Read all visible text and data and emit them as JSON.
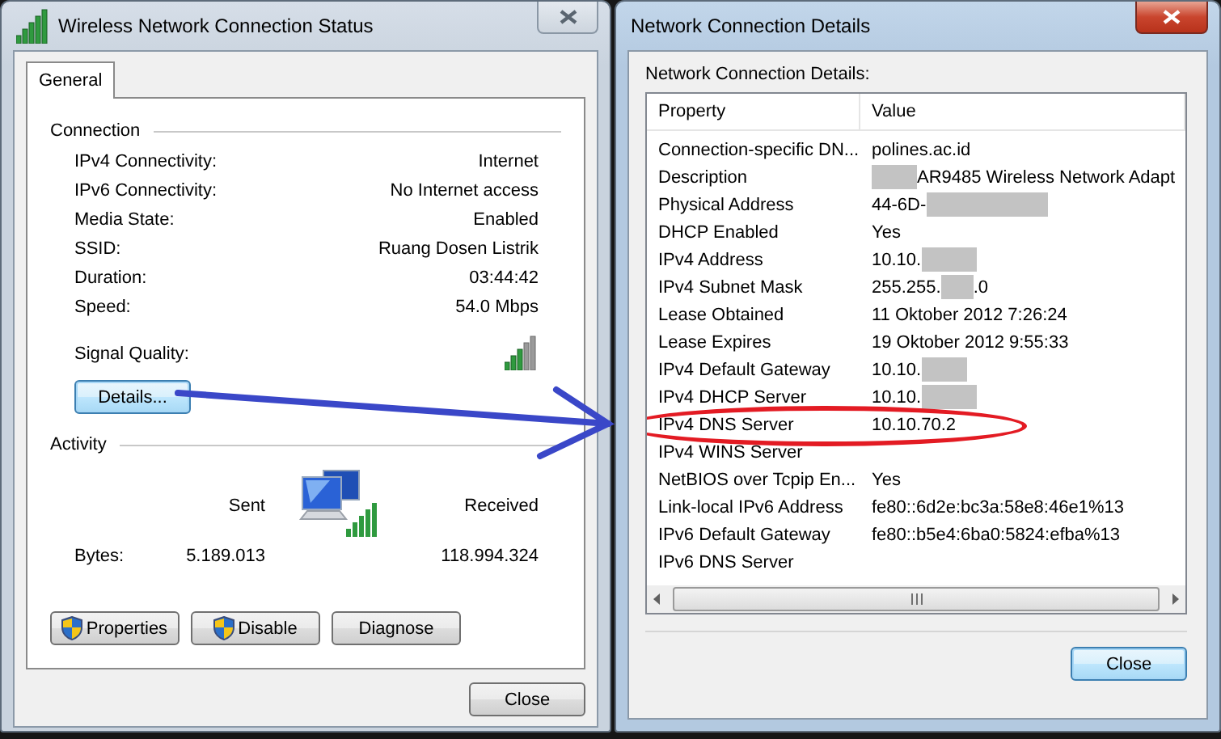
{
  "status_window": {
    "title": "Wireless Network Connection Status",
    "active": false,
    "tabs": [
      {
        "label": "General",
        "selected": true
      }
    ],
    "connection": {
      "heading": "Connection",
      "rows": [
        {
          "label": "IPv4 Connectivity:",
          "value": "Internet"
        },
        {
          "label": "IPv6 Connectivity:",
          "value": "No Internet access"
        },
        {
          "label": "Media State:",
          "value": "Enabled"
        },
        {
          "label": "SSID:",
          "value": "Ruang Dosen Listrik"
        },
        {
          "label": "Duration:",
          "value": "03:44:42"
        },
        {
          "label": "Speed:",
          "value": "54.0 Mbps"
        }
      ],
      "signal_label": "Signal Quality:"
    },
    "details_button": "Details...",
    "activity": {
      "heading": "Activity",
      "sent_label": "Sent",
      "received_label": "Received",
      "bytes_label": "Bytes:",
      "sent_value": "5.189.013",
      "received_value": "118.994.324"
    },
    "buttons": [
      {
        "label": "Properties",
        "kind": "shield"
      },
      {
        "label": "Disable",
        "kind": "shield"
      },
      {
        "label": "Diagnose",
        "kind": "plain"
      }
    ],
    "close_button": "Close"
  },
  "details_window": {
    "title": "Network Connection Details",
    "active": true,
    "list_label": "Network Connection Details:",
    "columns": [
      "Property",
      "Value"
    ],
    "rows": [
      {
        "property": "Connection-specific DN...",
        "value": [
          {
            "kind": "text",
            "text": "polines.ac.id"
          }
        ],
        "highlighted": false
      },
      {
        "property": "Description",
        "value": [
          {
            "kind": "redacted"
          },
          {
            "kind": "text",
            "text": "AR9485 Wireless Network Adapt"
          }
        ],
        "highlighted": false
      },
      {
        "property": "Physical Address",
        "value": [
          {
            "kind": "text",
            "text": "44-6D-"
          },
          {
            "kind": "redacted"
          }
        ],
        "highlighted": false
      },
      {
        "property": "DHCP Enabled",
        "value": [
          {
            "kind": "text",
            "text": "Yes"
          }
        ],
        "highlighted": false
      },
      {
        "property": "IPv4 Address",
        "value": [
          {
            "kind": "text",
            "text": "10.10."
          },
          {
            "kind": "redacted"
          }
        ],
        "highlighted": false
      },
      {
        "property": "IPv4 Subnet Mask",
        "value": [
          {
            "kind": "text",
            "text": "255.255."
          },
          {
            "kind": "redacted"
          },
          {
            "kind": "text",
            "text": ".0"
          }
        ],
        "highlighted": false
      },
      {
        "property": "Lease Obtained",
        "value": [
          {
            "kind": "text",
            "text": "11 Oktober 2012 7:26:24"
          }
        ],
        "highlighted": false
      },
      {
        "property": "Lease Expires",
        "value": [
          {
            "kind": "text",
            "text": "19 Oktober 2012 9:55:33"
          }
        ],
        "highlighted": false
      },
      {
        "property": "IPv4 Default Gateway",
        "value": [
          {
            "kind": "text",
            "text": "10.10."
          },
          {
            "kind": "redacted"
          }
        ],
        "highlighted": false
      },
      {
        "property": "IPv4 DHCP Server",
        "value": [
          {
            "kind": "text",
            "text": "10.10."
          },
          {
            "kind": "redacted"
          }
        ],
        "highlighted": false
      },
      {
        "property": "IPv4 DNS Server",
        "value": [
          {
            "kind": "text",
            "text": "10.10.70.2"
          }
        ],
        "highlighted": true
      },
      {
        "property": "IPv4 WINS Server",
        "value": [],
        "highlighted": false
      },
      {
        "property": "NetBIOS over Tcpip En...",
        "value": [
          {
            "kind": "text",
            "text": "Yes"
          }
        ],
        "highlighted": false
      },
      {
        "property": "Link-local IPv6 Address",
        "value": [
          {
            "kind": "text",
            "text": "fe80::6d2e:bc3a:58e8:46e1%13"
          }
        ],
        "highlighted": false
      },
      {
        "property": "IPv6 Default Gateway",
        "value": [
          {
            "kind": "text",
            "text": "fe80::b5e4:6ba0:5824:efba%13"
          }
        ],
        "highlighted": false
      },
      {
        "property": "IPv6 DNS Server",
        "value": [],
        "highlighted": false
      }
    ],
    "close_button": "Close"
  }
}
